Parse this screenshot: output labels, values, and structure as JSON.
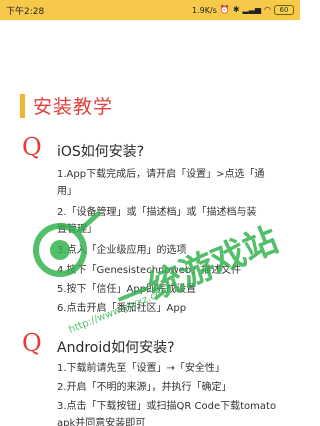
{
  "status_bar": {
    "time": "下午2:28",
    "speed": "1.9K/s",
    "battery": "60"
  },
  "page": {
    "title": "安装教学"
  },
  "ios": {
    "q": "Q",
    "title": "iOS如何安装?",
    "steps": [
      "1.App下载完成后，请开启「设置」>点选「通",
      "用」",
      "2.「设备管理」或「描述档」或「描述档与装",
      "置管理」",
      "3.点入「企业级应用」的选项",
      "4.按下「Genesistechnoweb」描述文件",
      "5.按下「信任」App即完成设置",
      "6.点击开启「番茄社区」App"
    ]
  },
  "android": {
    "q": "Q",
    "title": "Android如何安装?",
    "steps": [
      "1.下载前请先至「设置」→「安全性」",
      "2.开启「不明的来源」，并执行「确定」",
      "3.点击「下载按钮」或扫描QR Code下载tomato",
      "apk并同意安装即可"
    ]
  },
  "watermark": {
    "text": "一统游戏站",
    "url": "http://www.ytyxz.com"
  },
  "colors": {
    "status_bg": "#f7c94a",
    "accent_red": "#e53a35",
    "title_bar": "#f1b52f",
    "watermark_green": "#2fb14a"
  }
}
